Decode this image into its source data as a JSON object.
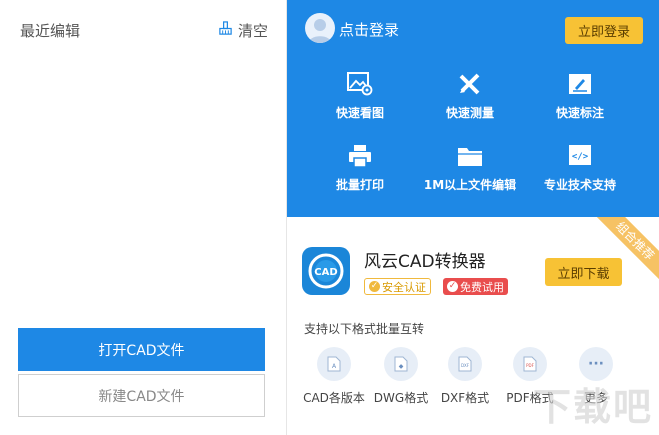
{
  "left_panel": {
    "recent_title": "最近编辑",
    "clear_label": "清空",
    "open_button": "打开CAD文件",
    "new_button": "新建CAD文件"
  },
  "account": {
    "login_text": "点击登录",
    "login_button": "立即登录"
  },
  "features": [
    {
      "label": "快速看图",
      "icon": "image-view-icon"
    },
    {
      "label": "快速测量",
      "icon": "measure-tools-icon"
    },
    {
      "label": "快速标注",
      "icon": "annotate-icon"
    },
    {
      "label": "批量打印",
      "icon": "printer-icon"
    },
    {
      "label": "1M以上文件编辑",
      "icon": "folder-icon"
    },
    {
      "label": "专业技术支持",
      "icon": "code-tag-icon"
    }
  ],
  "promo": {
    "ribbon": "组合推荐",
    "icon_text": "CAD",
    "app_name": "风云CAD转换器",
    "badge_safe": "安全认证",
    "badge_free": "免费试用",
    "download_button": "立即下载",
    "support_text": "支持以下格式批量互转",
    "formats": [
      {
        "label": "CAD各版本",
        "icon_text": "A"
      },
      {
        "label": "DWG格式",
        "icon_text": "◆"
      },
      {
        "label": "DXF格式",
        "icon_text": "DXF"
      },
      {
        "label": "PDF格式",
        "icon_text": "PDF"
      },
      {
        "label": "更多",
        "icon_text": "···"
      }
    ],
    "watermark": "下载吧"
  },
  "colors": {
    "accent_blue": "#1e88e5",
    "button_yellow": "#f7c235",
    "badge_red": "#e94d4d"
  }
}
